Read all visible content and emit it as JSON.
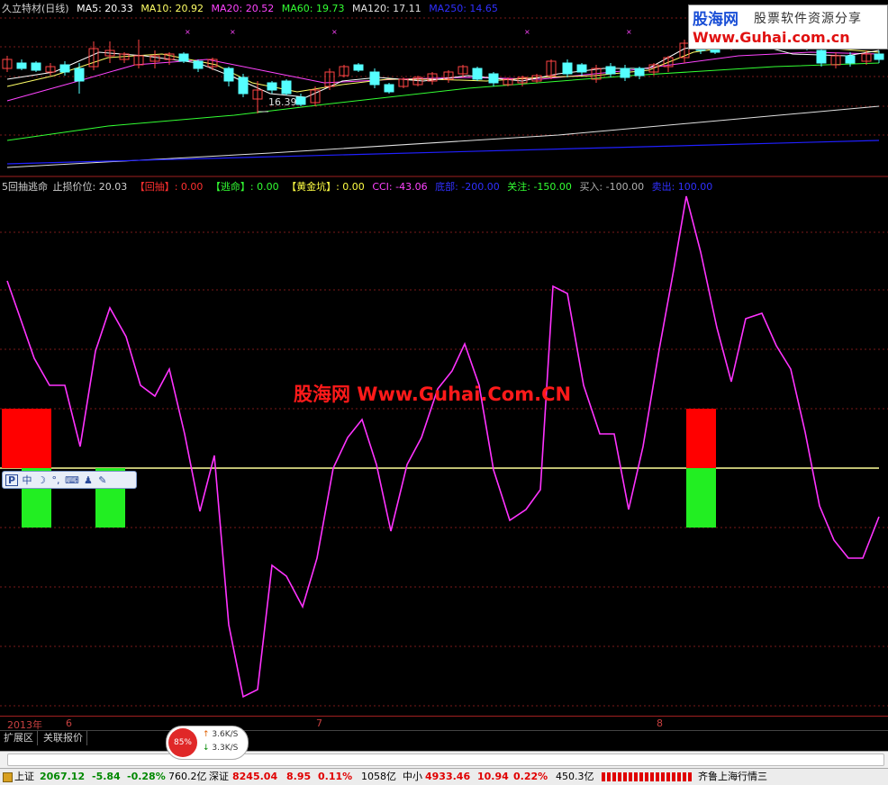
{
  "price_header": {
    "name": "久立特材(日线)",
    "ma5": "MA5: 20.33",
    "ma10": "MA10: 20.92",
    "ma20": "MA20: 20.52",
    "ma60": "MA60: 19.73",
    "ma120": "MA120: 17.11",
    "ma250": "MA250: 14.65"
  },
  "low_marker": "16.39",
  "indicator_header": {
    "name": "5回抽逃命",
    "stop": "止损价位: 20.03",
    "huichou_label": "【回抽】",
    "huichou_value": ": 0.00",
    "taoming_label": "【逃命】",
    "taoming_value": ": 0.00",
    "huangjin_label": "【黄金坑】",
    "huangjin_value": ": 0.00",
    "cci": "CCI: -43.06",
    "dibu": "底部: -200.00",
    "guanzhu": "关注: -150.00",
    "mairu": "买入: -100.00",
    "maichu": "卖出: 100.00"
  },
  "watermark": {
    "brand": "股海网",
    "slogan": "股票软件资源分享",
    "url": "Www.Guhai.com.cn",
    "center": "股海网 Www.Guhai.Com.CN"
  },
  "ime": {
    "logo": "P",
    "mode": "中",
    "moon": "☽",
    "punct": "°,",
    "keyboard": "⌨",
    "user": "♟",
    "tool": "✎"
  },
  "xaxis": {
    "year": "2013年",
    "m6": "6",
    "m7": "7",
    "m8": "8"
  },
  "tabs": [
    "扩展区",
    "关联报价"
  ],
  "speed": {
    "percent": "85%",
    "up": "3.6K/S",
    "down": "3.3K/S",
    "up_arrow": "↑",
    "down_arrow": "↓"
  },
  "status": {
    "sh_label": "上证",
    "sh_value": "2067.12",
    "sh_change": "-5.84",
    "sh_pct": "-0.28%",
    "sh_amount": "760.2亿",
    "sz_label": "深证",
    "sz_value": "8245.04",
    "sz_change": "8.95",
    "sz_pct": "0.11%",
    "sz_amount": "1058亿",
    "zx_label": "中小",
    "zx_value": "4933.46",
    "zx_change": "10.94",
    "zx_pct": "0.22%",
    "zx_amount": "450.3亿",
    "feed": "齐鲁上海行情三"
  },
  "colors": {
    "bg": "#000000",
    "ma5": "#ffffff",
    "ma10": "#ffff66",
    "ma20": "#ff44ff",
    "ma60": "#33ff33",
    "ma120": "#e0e0e0",
    "ma250": "#2020ff",
    "cci_line": "#ff33ff",
    "zero_line": "#ffff99",
    "up_candle": "#ff4444",
    "down_candle": "#55ffff"
  }
}
